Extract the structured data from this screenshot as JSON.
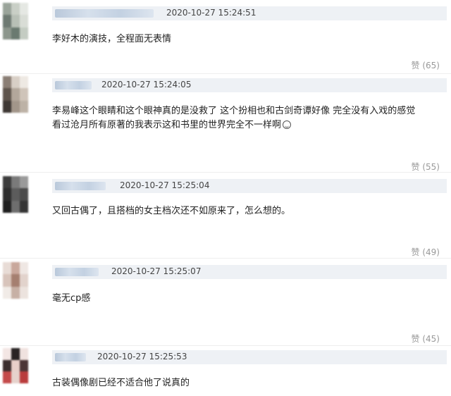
{
  "comments": [
    {
      "time": "2020-10-27 15:24:51",
      "lines": [
        "李好木的演技，全程面无表情"
      ],
      "like_word": "赞",
      "like_count": "(65)"
    },
    {
      "time": "2020-10-27 15:24:05",
      "lines": [
        "李易峰这个眼睛和这个眼神真的是没救了 这个扮相也和古剑奇谭好像 完全没有入戏的感觉",
        "看过沧月所有原著的我表示这和书里的世界完全不一样啊"
      ],
      "like_word": "赞",
      "like_count": "(55)"
    },
    {
      "time": "2020-10-27 15:25:04",
      "lines": [
        "又回古偶了，且搭档的女主档次还不如原来了，怎么想的。"
      ],
      "like_word": "赞",
      "like_count": "(49)"
    },
    {
      "time": "2020-10-27 15:25:07",
      "lines": [
        "毫无cp感"
      ],
      "like_word": "赞",
      "like_count": "(45)"
    },
    {
      "time": "2020-10-27 15:25:53",
      "lines": [
        "古装偶像剧已经不适合他了说真的"
      ]
    }
  ],
  "icons": {
    "emoji": "smile-emoji-icon"
  },
  "colors": {
    "meta_bar": "#eef1f5",
    "like_text": "#999999",
    "body_text": "#222222"
  }
}
